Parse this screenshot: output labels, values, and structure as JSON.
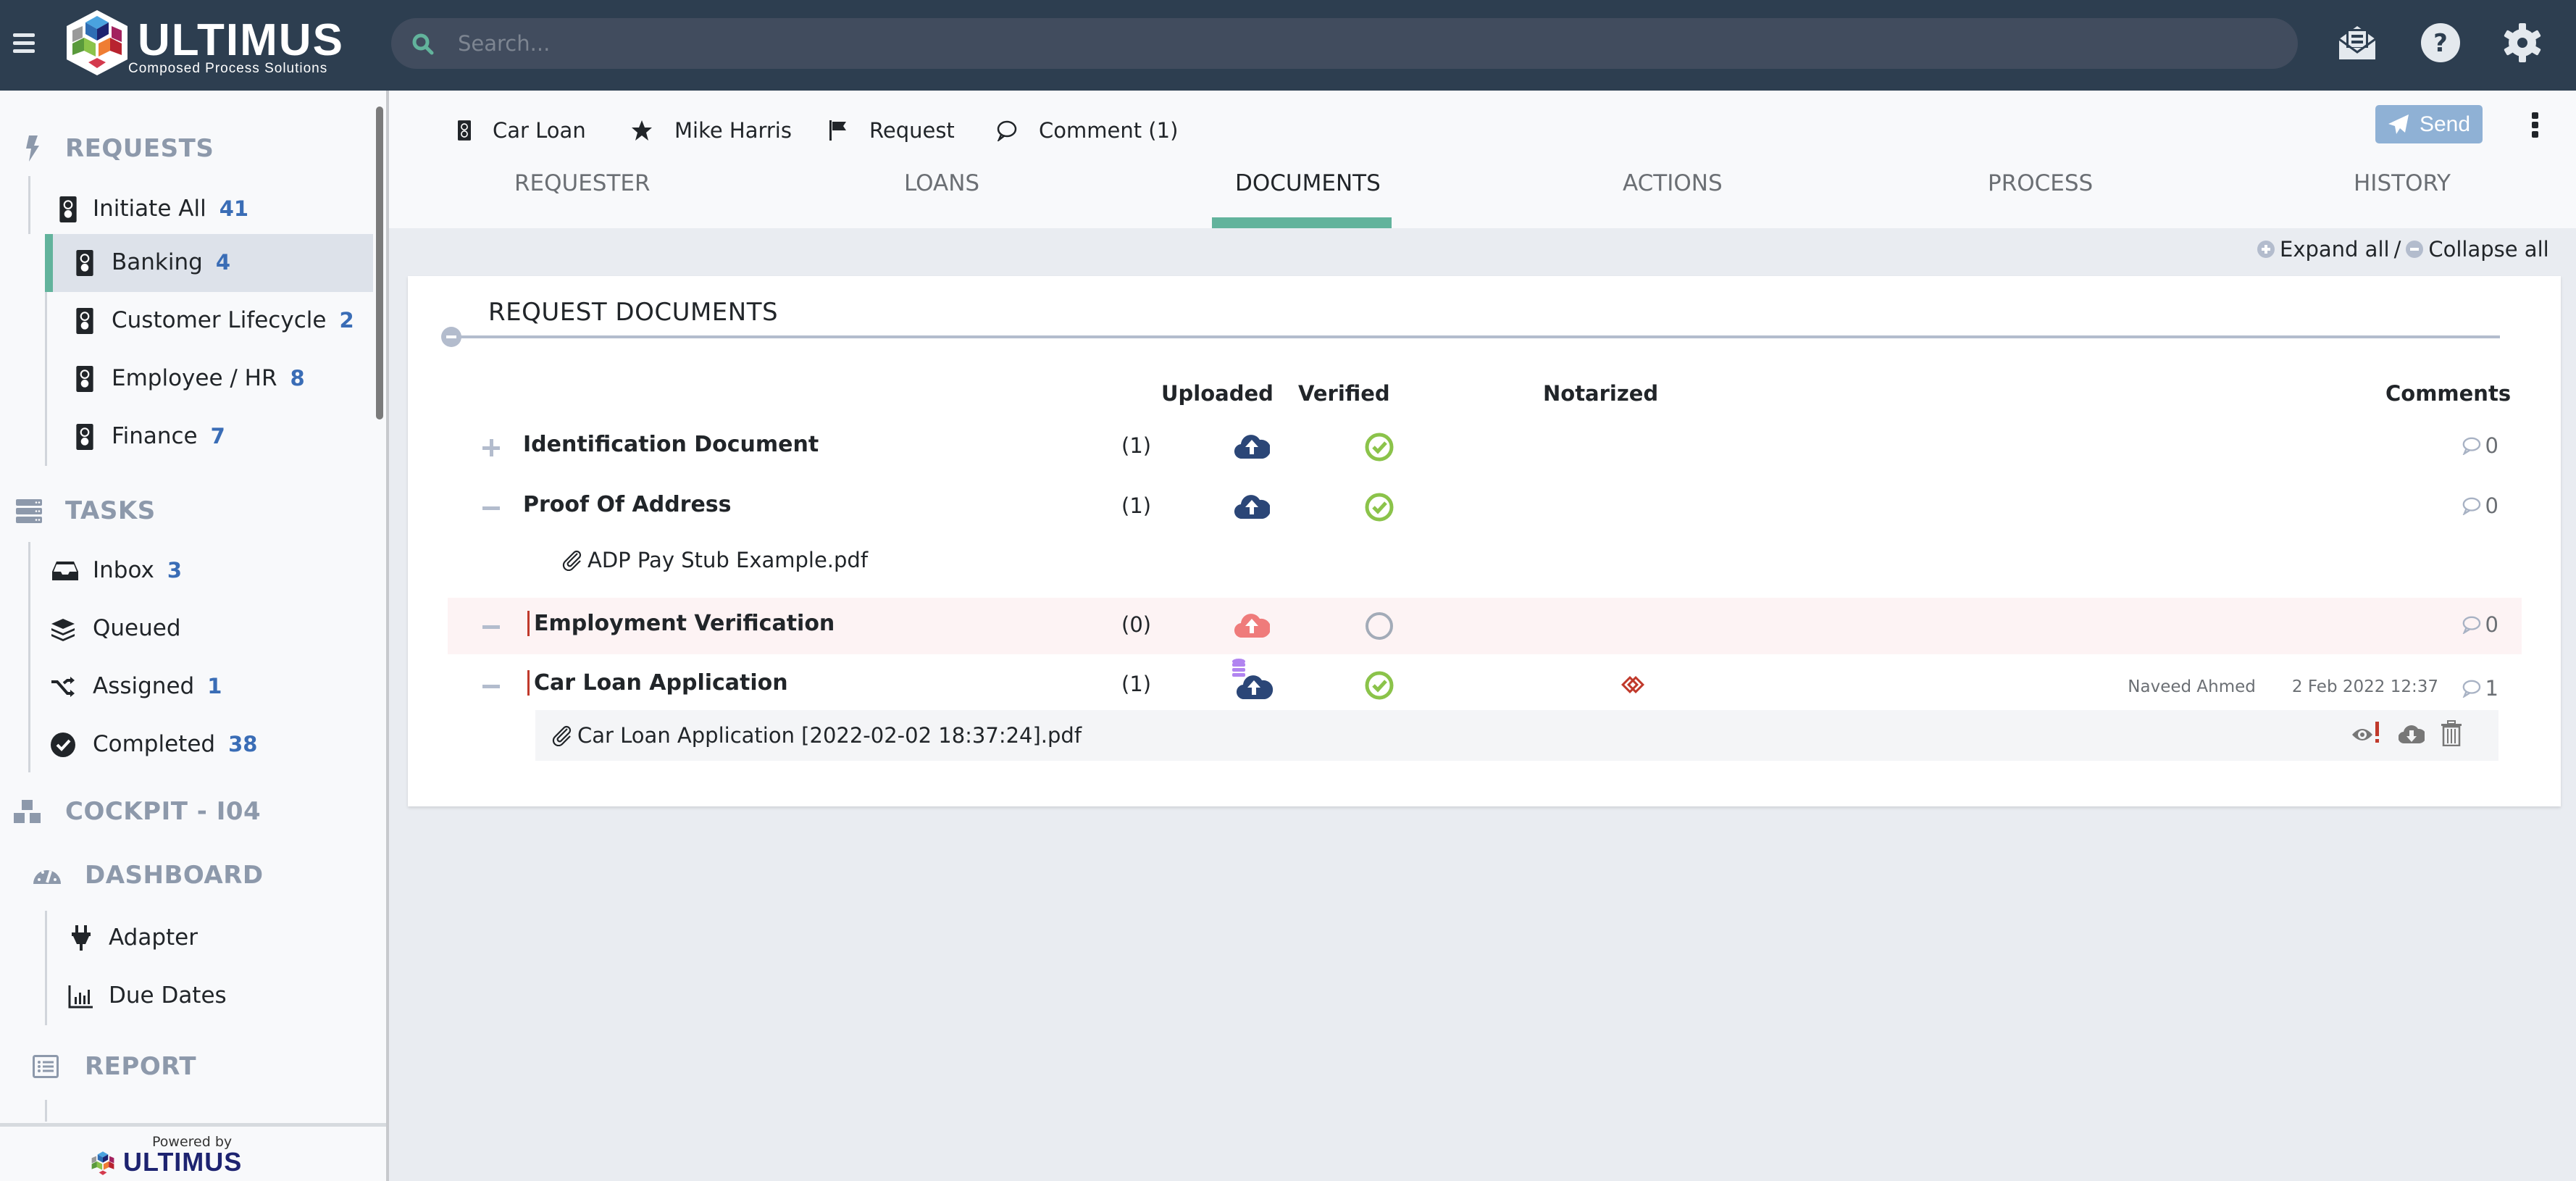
{
  "topbar": {
    "brand": "ULTIMUS",
    "brand_tagline": "Composed Process Solutions",
    "search_placeholder": "Search...",
    "icons": [
      "menu-icon",
      "search-icon",
      "envelope-open-icon",
      "help-icon",
      "gear-icon"
    ]
  },
  "sidebar": {
    "sections": [
      {
        "label": "REQUESTS",
        "icon": "bolt-icon",
        "items": [
          {
            "label": "Initiate All",
            "count": "41",
            "icon": "traffic-light-icon"
          },
          {
            "label": "Banking",
            "count": "4",
            "icon": "traffic-light-icon",
            "active": true
          },
          {
            "label": "Customer Lifecycle",
            "count": "2",
            "icon": "traffic-light-icon"
          },
          {
            "label": "Employee / HR",
            "count": "8",
            "icon": "traffic-light-icon"
          },
          {
            "label": "Finance",
            "count": "7",
            "icon": "traffic-light-icon"
          }
        ]
      },
      {
        "label": "TASKS",
        "icon": "server-icon",
        "items": [
          {
            "label": "Inbox",
            "count": "3",
            "icon": "inbox-icon"
          },
          {
            "label": "Queued",
            "count": "",
            "icon": "layers-icon"
          },
          {
            "label": "Assigned",
            "count": "1",
            "icon": "shuffle-icon"
          },
          {
            "label": "Completed",
            "count": "38",
            "icon": "check-circle-icon"
          }
        ]
      },
      {
        "label": "COCKPIT - I04",
        "icon": "boxes-icon",
        "items": []
      },
      {
        "label": "DASHBOARD",
        "icon": "gauge-icon",
        "items": [
          {
            "label": "Adapter",
            "count": "",
            "icon": "plug-icon"
          },
          {
            "label": "Due Dates",
            "count": "",
            "icon": "bar-chart-icon"
          }
        ]
      },
      {
        "label": "REPORT",
        "icon": "list-icon",
        "items": []
      }
    ],
    "footer": {
      "powered_by": "Powered by",
      "brand": "ULTIMUS"
    }
  },
  "header": {
    "breadcrumb": [
      {
        "label": "Car Loan",
        "icon": "traffic-light-icon"
      },
      {
        "label": "Mike Harris",
        "icon": "star-icon"
      },
      {
        "label": "Request",
        "icon": "flag-icon"
      },
      {
        "label": "Comment (1)",
        "icon": "comment-icon"
      }
    ],
    "send_label": "Send",
    "tabs": [
      {
        "label": "REQUESTER"
      },
      {
        "label": "LOANS"
      },
      {
        "label": "DOCUMENTS",
        "active": true
      },
      {
        "label": "ACTIONS"
      },
      {
        "label": "PROCESS"
      },
      {
        "label": "HISTORY"
      }
    ]
  },
  "toolbar": {
    "expand_all": "Expand all",
    "separator": "/",
    "collapse_all": "Collapse all"
  },
  "documents": {
    "title": "REQUEST DOCUMENTS",
    "columns": {
      "uploaded": "Uploaded",
      "verified": "Verified",
      "notarized": "Notarized",
      "comments": "Comments"
    },
    "rows": [
      {
        "name": "Identification Document",
        "count": "(1)",
        "uploaded": "uploaded",
        "verified": "verified",
        "notarized": "",
        "comments": "0",
        "expanded": false,
        "required": false,
        "warning": false
      },
      {
        "name": "Proof Of Address",
        "count": "(1)",
        "uploaded": "uploaded",
        "verified": "verified",
        "notarized": "",
        "comments": "0",
        "expanded": true,
        "required": false,
        "warning": false,
        "files": [
          {
            "name": "ADP Pay Stub Example.pdf"
          }
        ]
      },
      {
        "name": "Employment Verification",
        "count": "(0)",
        "uploaded": "missing",
        "verified": "pending",
        "notarized": "",
        "comments": "0",
        "expanded": true,
        "required": true,
        "warning": true
      },
      {
        "name": "Car Loan Application",
        "count": "(1)",
        "uploaded": "uploaded-db",
        "verified": "verified",
        "notarized": "notarize-required",
        "comments": "1",
        "expanded": true,
        "required": true,
        "warning": false,
        "author": "Naveed Ahmed",
        "date": "2 Feb 2022 12:37",
        "files": [
          {
            "name": "Car Loan Application [2022-02-02 18:37:24].pdf",
            "actions": [
              "view-alert-icon",
              "cloud-download-icon",
              "trash-icon"
            ]
          }
        ]
      }
    ]
  },
  "colors": {
    "topbar": "#2d3e50",
    "accent": "#62b39c",
    "count_blue": "#3a6db6",
    "upload_ok": "#2b4677",
    "upload_missing": "#ef7b7b",
    "verified": "#8bc34a",
    "required_marker": "#c0392b",
    "send_button": "#8fb1d5"
  }
}
